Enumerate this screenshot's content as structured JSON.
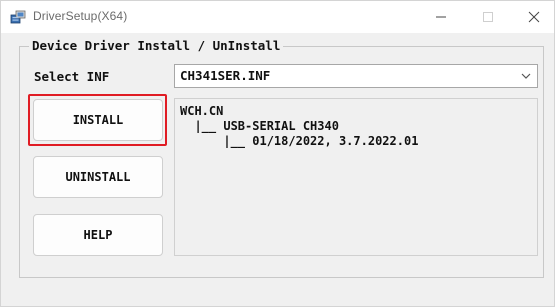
{
  "window": {
    "title": "DriverSetup(X64)",
    "controls": {
      "minimize_icon": "minimize-icon",
      "maximize_icon": "maximize-icon",
      "close_icon": "close-icon"
    }
  },
  "group": {
    "title": "Device Driver Install / UnInstall"
  },
  "select_inf": {
    "label": "Select INF",
    "value": "CH341SER.INF"
  },
  "buttons": {
    "install": "INSTALL",
    "uninstall": "UNINSTALL",
    "help": "HELP"
  },
  "info": {
    "line1": "WCH.CN",
    "line2": "  |__ USB-SERIAL CH340",
    "line3": "      |__ 01/18/2022, 3.7.2022.01"
  },
  "colors": {
    "highlight": "#e01c24"
  }
}
